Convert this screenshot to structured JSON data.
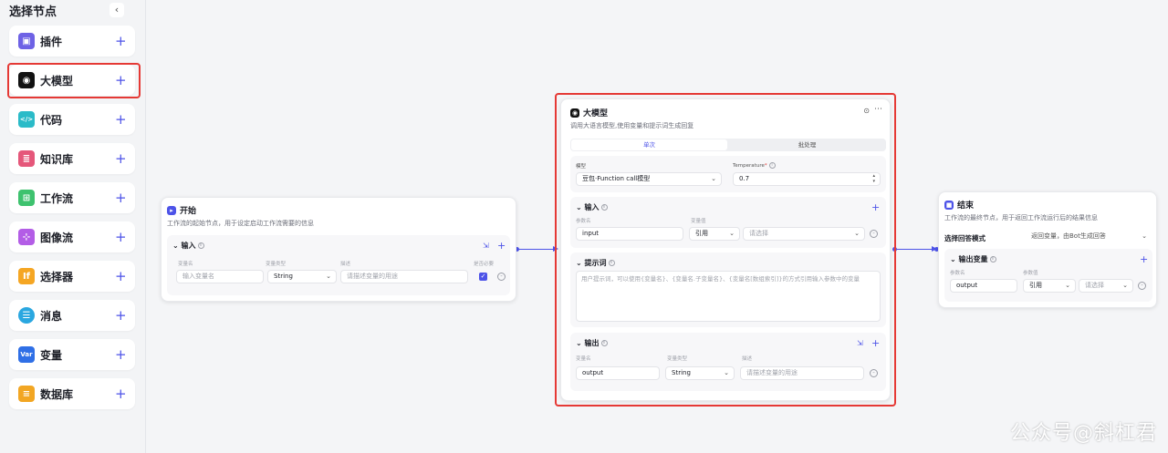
{
  "sidebar": {
    "title": "选择节点",
    "collapse_icon": "‹",
    "items": [
      {
        "label": "插件",
        "icon": "plugin-icon",
        "color": "#6e62e5"
      },
      {
        "label": "大模型",
        "icon": "llm-icon",
        "color": "#111111"
      },
      {
        "label": "代码",
        "icon": "code-icon",
        "color": "#2bbbc8"
      },
      {
        "label": "知识库",
        "icon": "knowledge-icon",
        "color": "#e5577a"
      },
      {
        "label": "工作流",
        "icon": "workflow-icon",
        "color": "#3ec26e"
      },
      {
        "label": "图像流",
        "icon": "imageflow-icon",
        "color": "#b35de6"
      },
      {
        "label": "选择器",
        "icon": "selector-icon",
        "color": "#f5a623"
      },
      {
        "label": "消息",
        "icon": "message-icon",
        "color": "#2aa7e0"
      },
      {
        "label": "变量",
        "icon": "variable-icon",
        "color": "#2f6fe6"
      },
      {
        "label": "数据库",
        "icon": "database-icon",
        "color": "#f2a623"
      }
    ],
    "item_icon_text": [
      "▣",
      "◉",
      "</>",
      "≣",
      "⊞",
      "⊹",
      "If",
      "☰",
      "Var",
      "≡"
    ],
    "plus": "+"
  },
  "start_node": {
    "title": "开始",
    "desc": "工作流的起始节点，用于设定启动工作流需要的信息",
    "input_title": "输入",
    "col_labels": [
      "变量名",
      "变量类型",
      "描述",
      "是否必要"
    ],
    "name_placeholder": "输入变量名",
    "type_value": "String",
    "desc_placeholder": "请描述变量的用途"
  },
  "llm_node": {
    "title": "大模型",
    "desc": "调用大语言模型,使用变量和提示词生成回复",
    "tabs": [
      "单次",
      "批处理"
    ],
    "model_label": "模型",
    "model_value": "豆包·Function call模型",
    "temp_label": "Temperature",
    "temp_value": "0.7",
    "input_title": "输入",
    "param_label": "参数名",
    "value_label": "变量值",
    "input_name": "input",
    "ref_label": "引用",
    "select_placeholder": "请选择",
    "prompt_title": "提示词",
    "prompt_placeholder": "用户提示词，可以使用{变量名}、{变量名.子变量名}、{变量名[数组索引]}的方式引用输入参数中的变量",
    "output_title": "输出",
    "out_col_labels": [
      "变量名",
      "变量类型",
      "描述"
    ],
    "output_name": "output",
    "output_type": "String",
    "output_desc_placeholder": "请描述变量的用途"
  },
  "end_node": {
    "title": "结束",
    "desc": "工作流的最终节点，用于返回工作流运行后的结果信息",
    "mode_label": "选择回答模式",
    "mode_value": "返回变量，由Bot生成回答",
    "output_title": "输出变量",
    "param_label": "参数名",
    "value_label": "参数值",
    "output_name": "output",
    "ref_label": "引用",
    "select_placeholder": "请选择"
  },
  "watermark": "公众号@斜杠君",
  "colors": {
    "accent": "#4d53e8",
    "highlight": "#e53935"
  }
}
